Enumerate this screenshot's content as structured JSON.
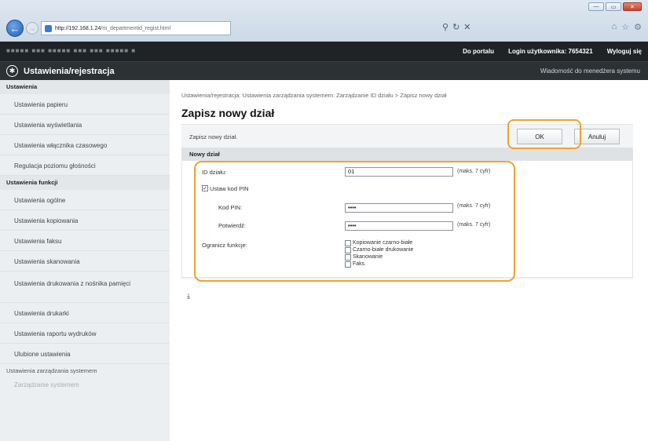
{
  "browser": {
    "url_host": "http://192.168.1.24",
    "url_path": "/m_departmentid_regist.html",
    "window_buttons": [
      "—",
      "▭",
      "✕"
    ],
    "tools_icons": [
      "search-icon",
      "refresh-icon",
      "close-icon"
    ],
    "right_icons": [
      "home-icon",
      "star-icon",
      "gear-icon"
    ]
  },
  "top_strip": {
    "device_name": "■■■■■ ■■■ ■■■■■ ■■■ ■■■ ■■■■■ ■",
    "portal_link": "Do portalu",
    "login_label": "Login użytkownika:",
    "login_id": "7654321",
    "logout_link": "Wyloguj się"
  },
  "title_bar": {
    "title": "Ustawienia/rejestracja",
    "admin_link": "Wiadomość do menedżera systemu"
  },
  "sidebar": {
    "section_settings": "Ustawienia",
    "items_settings": [
      "Ustawienia papieru",
      "Ustawienia wyświetlania",
      "Ustawienia włącznika czasowego",
      "Regulacja poziomu głośności"
    ],
    "section_functions": "Ustawienia funkcji",
    "items_functions": [
      "Ustawienia ogólne",
      "Ustawienia kopiowania",
      "Ustawienia faksu",
      "Ustawienia skanowania",
      "Ustawienia drukowania z nośnika pamięci",
      "Ustawienia drukarki",
      "Ustawienia raportu wydruków",
      "Ulubione ustawienia"
    ],
    "section_mgmt": "Ustawienia zarządzania systemem",
    "item_dim": "Zarządzanie systemem"
  },
  "main": {
    "breadcrumb": "Ustawienia/rejestracja: Ustawienia zarządzania systemem: Zarządzanie ID działu > Zapisz nowy dział",
    "page_title": "Zapisz nowy dział",
    "description": "Zapisz nowy dział.",
    "ok_label": "OK",
    "cancel_label": "Anuluj",
    "panel_title": "Nowy dział",
    "dept_id_label": "ID działu:",
    "dept_id_value": "01",
    "dept_id_hint": "(maks. 7 cyfr)",
    "set_pin_label": "Ustaw kod PIN",
    "set_pin_checked": "✓",
    "pin_label": "Kod PIN:",
    "pin_value": "••••",
    "pin_hint": "(maks. 7 cyfr)",
    "confirm_label": "Potwierdź:",
    "confirm_value": "••••",
    "confirm_hint": "(maks. 7 cyfr)",
    "restrict_label": "Ogranicz funkcje:",
    "restrict_options": [
      "Kopiowanie czarno-białe",
      "Czarno-białe drukowanie",
      "Skanowanie",
      "Faks"
    ],
    "to_top_icon": "to-top-icon"
  },
  "colors": {
    "highlight": "#f0a22f",
    "header_dark": "#1f2326",
    "sidebar_bg": "#eceff1"
  }
}
